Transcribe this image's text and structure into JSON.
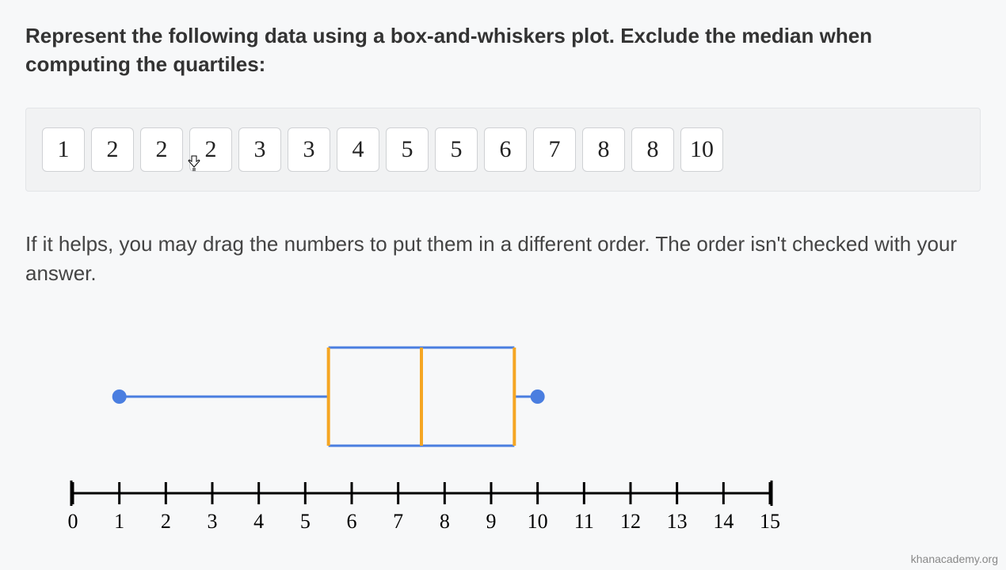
{
  "prompt": "Represent the following data using a box-and-whiskers plot. Exclude the median when computing the quartiles:",
  "data_values": [
    "1",
    "2",
    "2",
    "2",
    "3",
    "3",
    "4",
    "5",
    "5",
    "6",
    "7",
    "8",
    "8",
    "10"
  ],
  "hint": "If it helps, you may drag the numbers to put them in a different order. The order isn't checked with your answer.",
  "watermark": "khanacademy.org",
  "chart_data": {
    "type": "boxplot",
    "axis": {
      "min": 0,
      "max": 15,
      "step": 1
    },
    "box": {
      "min": 1,
      "q1": 5.5,
      "median": 7.5,
      "q3": 9.5,
      "max": 10
    },
    "colors": {
      "whisker": "#4a7ee0",
      "box_outline": "#f5a623",
      "point": "#4a7ee0"
    }
  }
}
